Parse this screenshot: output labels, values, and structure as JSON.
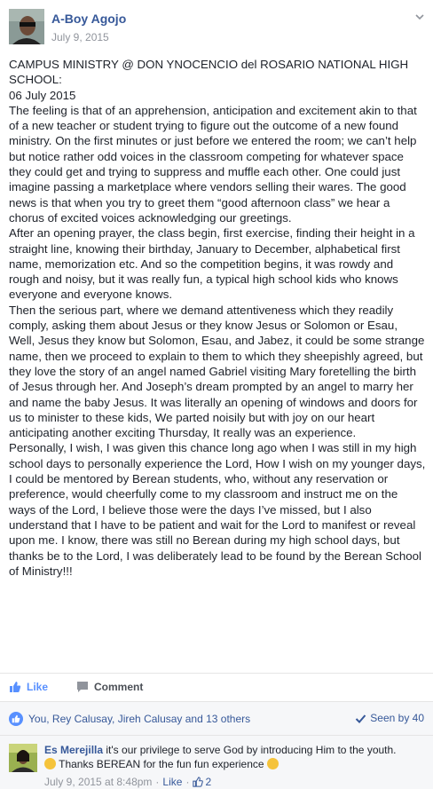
{
  "post": {
    "author": "A-Boy Agojo",
    "date": "July 9, 2015",
    "paragraphs": [
      "CAMPUS MINISTRY @ DON YNOCENCIO del ROSARIO NATIONAL HIGH SCHOOL:",
      "06 July 2015",
      "The feeling is that of an apprehension, anticipation and excitement akin to that of a new teacher or student trying to figure out the outcome of a new found ministry. On the first minutes or just before we entered the room; we can’t help but notice rather odd voices in the classroom competing for whatever space they could get and trying to suppress and muffle each other. One could just imagine passing a marketplace where vendors selling their wares. The good news is that when you try to greet them “good afternoon class” we hear a chorus of excited voices acknowledging our greetings.",
      "After an opening prayer, the class begin, first exercise, finding their height in a straight line, knowing their birthday, January to December, alphabetical first name, memorization etc. And so the competition begins, it was rowdy and rough and noisy, but it was really fun, a typical high school kids who knows everyone and everyone knows.",
      "Then the serious part, where we demand attentiveness which they readily comply, asking them about Jesus or they know Jesus or Solomon or Esau, Well, Jesus they know but Solomon, Esau, and Jabez, it could be some strange name, then we proceed to explain to them to which they sheepishly agreed, but they love the story of an angel named Gabriel visiting Mary foretelling the birth of Jesus through her. And Joseph’s dream prompted by an angel to marry her and name the baby Jesus. It was literally an opening of windows and doors for us to minister to these kids, We parted noisily but with joy on our heart anticipating another exciting Thursday, It really was an experience.",
      "Personally, I wish, I was given this chance long ago when I was still in my high school days to personally experience the Lord, How I wish on my younger days, I could be mentored by Berean students, who, without any reservation or preference, would cheerfully come to my classroom and instruct me on the ways of the Lord, I believe those were the days I’ve missed, but I also understand that I have to be patient and wait for the Lord to manifest or reveal upon me. I know, there was still no Berean during my high school days, but thanks be to the Lord, I was deliberately lead to be found by the Berean School of Ministry!!!"
    ]
  },
  "actions": {
    "like_label": "Like",
    "comment_label": "Comment"
  },
  "reactions": {
    "likers": "You, Rey Calusay, Jireh Calusay and 13 others",
    "seen": "Seen by 40"
  },
  "comment": {
    "author": "Es Merejilla",
    "text_part1": "it's our privilege to serve God by introducing Him to the youth.",
    "text_part2": "Thanks BEREAN for the fun fun experience",
    "date": "July 9, 2015 at 8:48pm",
    "like_label": "Like",
    "like_count": "2"
  },
  "colors": {
    "link": "#365899",
    "accent": "#5890ff",
    "muted": "#90949c"
  }
}
